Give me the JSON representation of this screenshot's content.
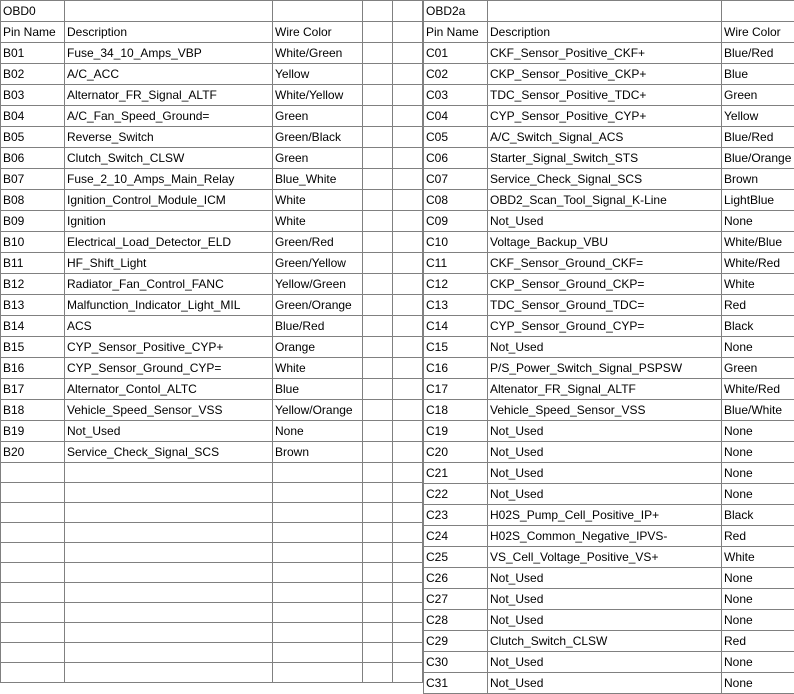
{
  "left": {
    "title": "OBD0",
    "headers": {
      "pin": "Pin Name",
      "desc": "Description",
      "wire": "Wire Color"
    },
    "rows": [
      {
        "pin": "B01",
        "desc": "Fuse_34_10_Amps_VBP",
        "wire": "White/Green"
      },
      {
        "pin": "B02",
        "desc": "A/C_ACC",
        "wire": "Yellow"
      },
      {
        "pin": "B03",
        "desc": "Alternator_FR_Signal_ALTF",
        "wire": "White/Yellow"
      },
      {
        "pin": "B04",
        "desc": "A/C_Fan_Speed_Ground=",
        "wire": "Green"
      },
      {
        "pin": "B05",
        "desc": "Reverse_Switch",
        "wire": "Green/Black"
      },
      {
        "pin": "B06",
        "desc": "Clutch_Switch_CLSW",
        "wire": "Green"
      },
      {
        "pin": "B07",
        "desc": "Fuse_2_10_Amps_Main_Relay",
        "wire": "Blue_White"
      },
      {
        "pin": "B08",
        "desc": "Ignition_Control_Module_ICM",
        "wire": "White"
      },
      {
        "pin": "B09",
        "desc": "Ignition",
        "wire": "White"
      },
      {
        "pin": "B10",
        "desc": "Electrical_Load_Detector_ELD",
        "wire": "Green/Red"
      },
      {
        "pin": "B11",
        "desc": "HF_Shift_Light",
        "wire": "Green/Yellow"
      },
      {
        "pin": "B12",
        "desc": "Radiator_Fan_Control_FANC",
        "wire": "Yellow/Green"
      },
      {
        "pin": "B13",
        "desc": "Malfunction_Indicator_Light_MIL",
        "wire": "Green/Orange"
      },
      {
        "pin": "B14",
        "desc": "ACS",
        "wire": "Blue/Red"
      },
      {
        "pin": "B15",
        "desc": "CYP_Sensor_Positive_CYP+",
        "wire": "Orange"
      },
      {
        "pin": "B16",
        "desc": "CYP_Sensor_Ground_CYP=",
        "wire": "White"
      },
      {
        "pin": "B17",
        "desc": "Alternator_Contol_ALTC",
        "wire": "Blue"
      },
      {
        "pin": "B18",
        "desc": "Vehicle_Speed_Sensor_VSS",
        "wire": "Yellow/Orange"
      },
      {
        "pin": "B19",
        "desc": "Not_Used",
        "wire": "None"
      },
      {
        "pin": "B20",
        "desc": "Service_Check_Signal_SCS",
        "wire": "Brown"
      }
    ],
    "blank_rows": 11
  },
  "right": {
    "title": "OBD2a",
    "headers": {
      "pin": "Pin Name",
      "desc": "Description",
      "wire": "Wire Color"
    },
    "rows": [
      {
        "pin": "C01",
        "desc": "CKF_Sensor_Positive_CKF+",
        "wire": "Blue/Red"
      },
      {
        "pin": "C02",
        "desc": "CKP_Sensor_Positive_CKP+",
        "wire": "Blue"
      },
      {
        "pin": "C03",
        "desc": "TDC_Sensor_Positive_TDC+",
        "wire": "Green"
      },
      {
        "pin": "C04",
        "desc": "CYP_Sensor_Positive_CYP+",
        "wire": "Yellow"
      },
      {
        "pin": "C05",
        "desc": "A/C_Switch_Signal_ACS",
        "wire": "Blue/Red"
      },
      {
        "pin": "C06",
        "desc": "Starter_Signal_Switch_STS",
        "wire": "Blue/Orange"
      },
      {
        "pin": "C07",
        "desc": "Service_Check_Signal_SCS",
        "wire": "Brown"
      },
      {
        "pin": "C08",
        "desc": "OBD2_Scan_Tool_Signal_K-Line",
        "wire": "LightBlue"
      },
      {
        "pin": "C09",
        "desc": "Not_Used",
        "wire": "None"
      },
      {
        "pin": "C10",
        "desc": "Voltage_Backup_VBU",
        "wire": "White/Blue"
      },
      {
        "pin": "C11",
        "desc": "CKF_Sensor_Ground_CKF=",
        "wire": "White/Red"
      },
      {
        "pin": "C12",
        "desc": "CKP_Sensor_Ground_CKP=",
        "wire": "White"
      },
      {
        "pin": "C13",
        "desc": "TDC_Sensor_Ground_TDC=",
        "wire": "Red"
      },
      {
        "pin": "C14",
        "desc": "CYP_Sensor_Ground_CYP=",
        "wire": "Black"
      },
      {
        "pin": "C15",
        "desc": "Not_Used",
        "wire": "None"
      },
      {
        "pin": "C16",
        "desc": "P/S_Power_Switch_Signal_PSPSW",
        "wire": "Green"
      },
      {
        "pin": "C17",
        "desc": "Altenator_FR_Signal_ALTF",
        "wire": "White/Red"
      },
      {
        "pin": "C18",
        "desc": "Vehicle_Speed_Sensor_VSS",
        "wire": "Blue/White"
      },
      {
        "pin": "C19",
        "desc": "Not_Used",
        "wire": "None"
      },
      {
        "pin": "C20",
        "desc": "Not_Used",
        "wire": "None"
      },
      {
        "pin": "C21",
        "desc": "Not_Used",
        "wire": "None"
      },
      {
        "pin": "C22",
        "desc": "Not_Used",
        "wire": "None"
      },
      {
        "pin": "C23",
        "desc": "H02S_Pump_Cell_Positive_IP+",
        "wire": "Black"
      },
      {
        "pin": "C24",
        "desc": "H02S_Common_Negative_IPVS-",
        "wire": "Red"
      },
      {
        "pin": "C25",
        "desc": "VS_Cell_Voltage_Positive_VS+",
        "wire": "White"
      },
      {
        "pin": "C26",
        "desc": "Not_Used",
        "wire": "None"
      },
      {
        "pin": "C27",
        "desc": "Not_Used",
        "wire": "None"
      },
      {
        "pin": "C28",
        "desc": "Not_Used",
        "wire": "None"
      },
      {
        "pin": "C29",
        "desc": "Clutch_Switch_CLSW",
        "wire": "Red"
      },
      {
        "pin": "C30",
        "desc": "Not_Used",
        "wire": "None"
      },
      {
        "pin": "C31",
        "desc": "Not_Used",
        "wire": "None"
      }
    ]
  }
}
